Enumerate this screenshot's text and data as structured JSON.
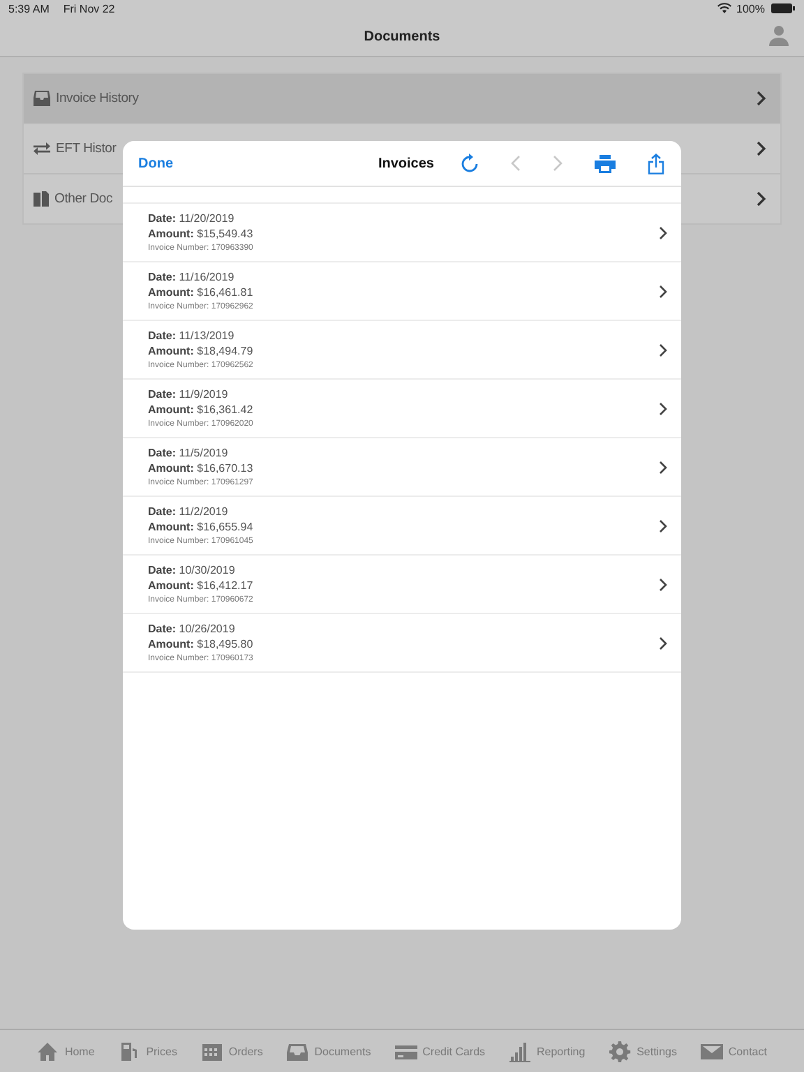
{
  "status_bar": {
    "time": "5:39 AM",
    "date": "Fri Nov 22",
    "battery": "100%"
  },
  "nav": {
    "title": "Documents"
  },
  "menu": [
    {
      "label": "Invoice History",
      "kind": "inbox",
      "selected": true
    },
    {
      "label": "EFT Histor",
      "kind": "transfer",
      "selected": false
    },
    {
      "label": "Other Doc",
      "kind": "docs",
      "selected": false
    }
  ],
  "modal": {
    "done": "Done",
    "title": "Invoices",
    "invoices": [
      {
        "date": "**Date:** 11/20/2019",
        "amount": "**Amount:** $15,549.43",
        "number": "Invoice Number: 170963390"
      },
      {
        "date": "**Date:** 11/16/2019",
        "amount": "**Amount:** $16,461.81",
        "number": "Invoice Number: 170962962"
      },
      {
        "date": "**Date:** 11/13/2019",
        "amount": "**Amount:** $18,494.79",
        "number": "Invoice Number: 170962562"
      },
      {
        "date": "**Date:** 11/9/2019",
        "amount": "**Amount:** $16,361.42",
        "number": "Invoice Number: 170962020"
      },
      {
        "date": "**Date:** 11/5/2019",
        "amount": "**Amount:** $16,670.13",
        "number": "Invoice Number: 170961297"
      },
      {
        "date": "**Date:** 11/2/2019",
        "amount": "**Amount:** $16,655.94",
        "number": "Invoice Number: 170961045"
      },
      {
        "date": "**Date:** 10/30/2019",
        "amount": "**Amount:** $16,412.17",
        "number": "Invoice Number: 170960672"
      },
      {
        "date": "**Date:** 10/26/2019",
        "amount": "**Amount:** $18,495.80",
        "number": "Invoice Number: 170960173"
      }
    ]
  },
  "tab_bar": [
    {
      "label": "Home",
      "kind": "home"
    },
    {
      "label": "Prices",
      "kind": "pump"
    },
    {
      "label": "Orders",
      "kind": "calendar"
    },
    {
      "label": "Documents",
      "kind": "inbox"
    },
    {
      "label": "Credit Cards",
      "kind": "card"
    },
    {
      "label": "Reporting",
      "kind": "chart"
    },
    {
      "label": "Settings",
      "kind": "gear"
    },
    {
      "label": "Contact",
      "kind": "mail"
    }
  ]
}
